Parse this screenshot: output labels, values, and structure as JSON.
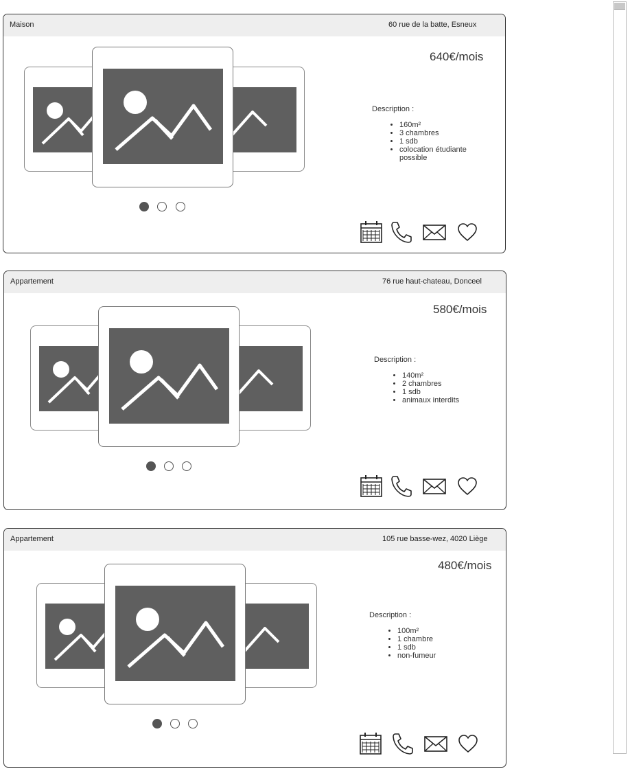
{
  "listings": [
    {
      "type": "Maison",
      "address": "60 rue de la batte, Esneux",
      "price": "640€/mois",
      "description_label": "Description :",
      "features": [
        "160m²",
        "3 chambres",
        "1 sdb",
        "colocation étudiante possible"
      ]
    },
    {
      "type": "Appartement",
      "address": "76 rue haut-chateau, Donceel",
      "price": "580€/mois",
      "description_label": "Description :",
      "features": [
        "140m²",
        "2 chambres",
        "1 sdb",
        "animaux interdits"
      ]
    },
    {
      "type": "Appartement",
      "address": "105 rue basse-wez, 4020 Liège",
      "price": "480€/mois",
      "description_label": "Description :",
      "features": [
        "100m²",
        "1 chambre",
        "1 sdb",
        "non-fumeur"
      ]
    }
  ],
  "carousel": {
    "slide_count": 3,
    "active_slide": 1
  },
  "actions": [
    "calendar-icon",
    "phone-icon",
    "mail-icon",
    "heart-icon"
  ],
  "colors": {
    "image_placeholder": "#5f5f5f",
    "header_bg": "#eeeeee",
    "border": "#333333"
  }
}
